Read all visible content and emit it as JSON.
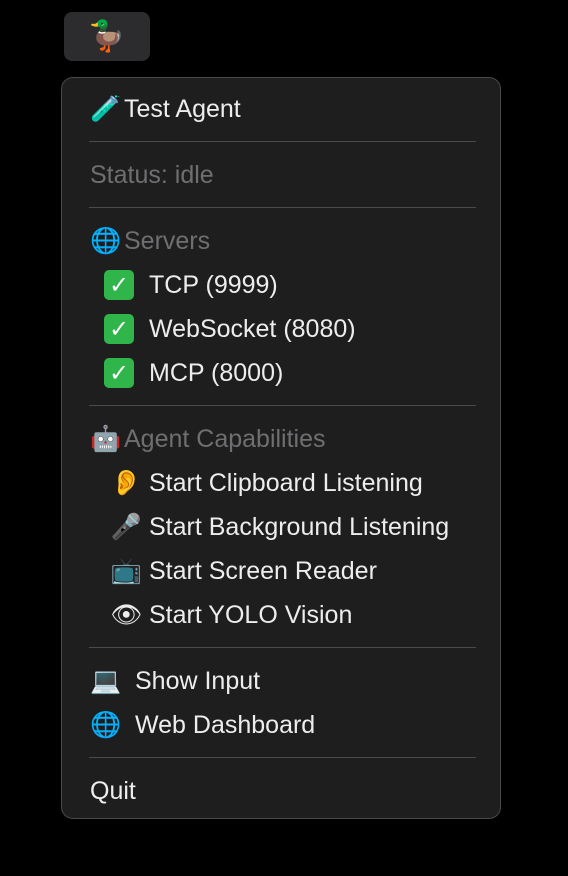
{
  "statusbar": {
    "icon": "duck-icon",
    "icon_glyph": "🦆"
  },
  "menu": {
    "test_agent": {
      "icon": "test-tube-icon",
      "icon_glyph": "🧪",
      "label": "Test Agent"
    },
    "status": {
      "label": "Status: idle"
    },
    "servers": {
      "header": {
        "icon": "globe-icon",
        "icon_glyph": "🌐",
        "label": "Servers"
      },
      "items": [
        {
          "icon": "check-mark-icon",
          "icon_glyph": "✓",
          "label": "TCP (9999)"
        },
        {
          "icon": "check-mark-icon",
          "icon_glyph": "✓",
          "label": "WebSocket (8080)"
        },
        {
          "icon": "check-mark-icon",
          "icon_glyph": "✓",
          "label": "MCP (8000)"
        }
      ]
    },
    "capabilities": {
      "header": {
        "icon": "robot-icon",
        "icon_glyph": "🤖",
        "label": "Agent Capabilities"
      },
      "items": [
        {
          "icon": "ear-icon",
          "icon_glyph": "👂",
          "label": "Start Clipboard Listening"
        },
        {
          "icon": "microphone-icon",
          "icon_glyph": "🎤",
          "label": "Start Background Listening"
        },
        {
          "icon": "television-icon",
          "icon_glyph": "📺",
          "label": "Start Screen Reader"
        },
        {
          "icon": "eye-icon",
          "icon_glyph": "👁",
          "label": "Start YOLO Vision"
        }
      ]
    },
    "show_input": {
      "icon": "laptop-icon",
      "icon_glyph": "💻",
      "label": "Show Input"
    },
    "web_dashboard": {
      "icon": "globe-icon",
      "icon_glyph": "🌐",
      "label": "Web Dashboard"
    },
    "quit": {
      "label": "Quit"
    }
  }
}
